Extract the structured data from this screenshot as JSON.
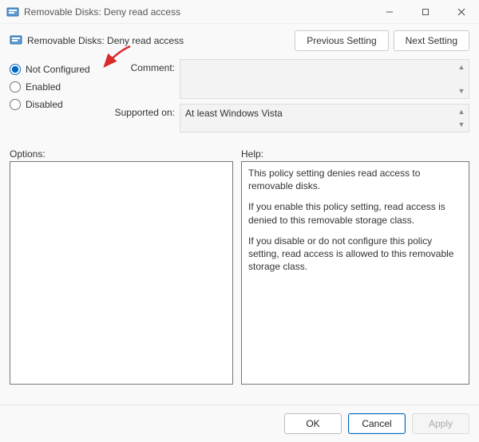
{
  "window": {
    "title": "Removable Disks: Deny read access"
  },
  "header": {
    "title": "Removable Disks: Deny read access",
    "prev_btn": "Previous Setting",
    "next_btn": "Next Setting"
  },
  "config": {
    "radios": {
      "not_configured": "Not Configured",
      "enabled": "Enabled",
      "disabled": "Disabled",
      "selected": "not_configured"
    },
    "comment_label": "Comment:",
    "comment_value": "",
    "supported_label": "Supported on:",
    "supported_value": "At least Windows Vista"
  },
  "sections": {
    "options_label": "Options:",
    "help_label": "Help:"
  },
  "help": {
    "p1": "This policy setting denies read access to removable disks.",
    "p2": "If you enable this policy setting, read access is denied to this removable storage class.",
    "p3": "If you disable or do not configure this policy setting, read access is allowed to this removable storage class."
  },
  "footer": {
    "ok": "OK",
    "cancel": "Cancel",
    "apply": "Apply"
  }
}
